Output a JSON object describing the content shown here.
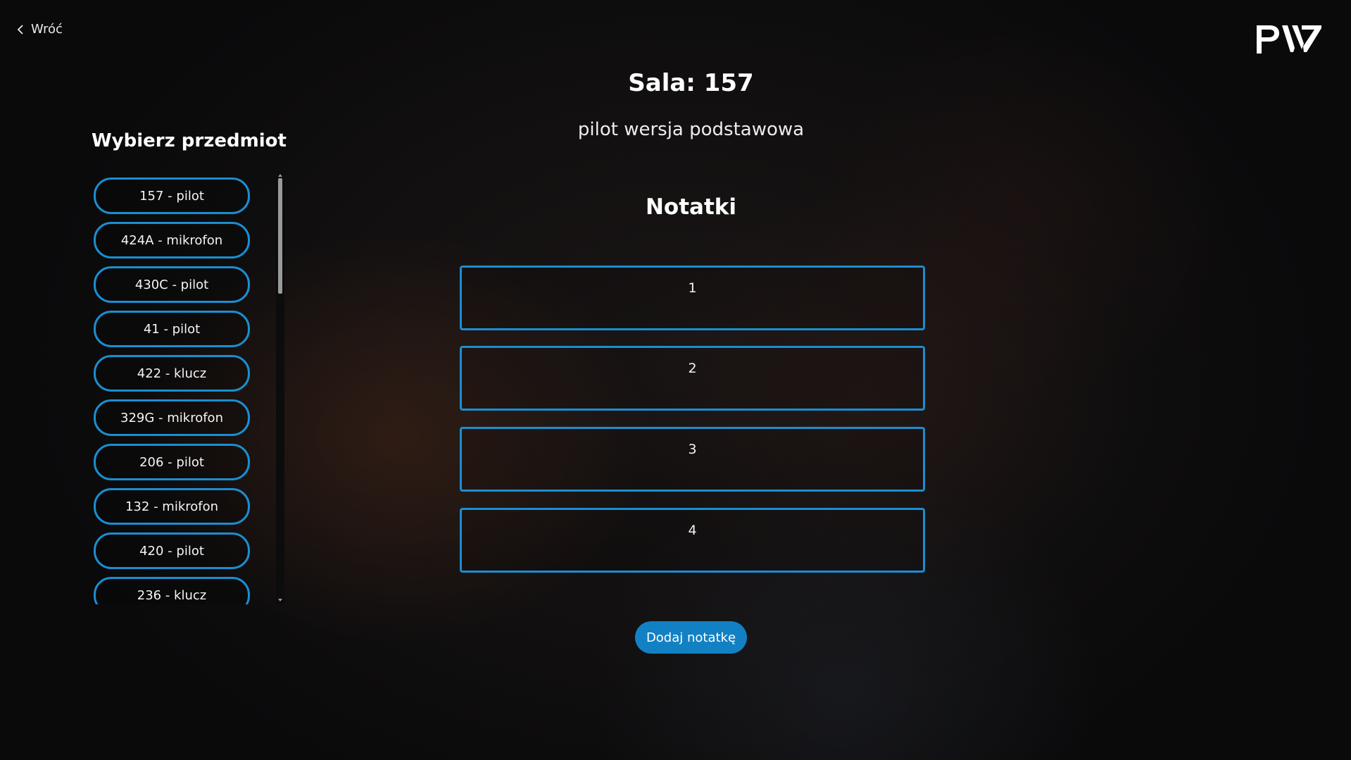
{
  "nav": {
    "back_label": "Wróć"
  },
  "logo": {
    "text": "PW"
  },
  "room": {
    "title": "Sala: 157",
    "subtitle": "pilot wersja podstawowa"
  },
  "sidebar": {
    "title": "Wybierz przedmiot",
    "items": [
      {
        "label": "157 - pilot"
      },
      {
        "label": "424A - mikrofon"
      },
      {
        "label": "430C - pilot"
      },
      {
        "label": "41 - pilot"
      },
      {
        "label": "422 - klucz"
      },
      {
        "label": "329G - mikrofon"
      },
      {
        "label": "206 - pilot"
      },
      {
        "label": "132 - mikrofon"
      },
      {
        "label": "420 - pilot"
      },
      {
        "label": "236 - klucz"
      }
    ]
  },
  "notes": {
    "title": "Notatki",
    "items": [
      {
        "text": "1"
      },
      {
        "text": "2"
      },
      {
        "text": "3"
      },
      {
        "text": "4"
      }
    ],
    "add_button_label": "Dodaj notatkę"
  },
  "colors": {
    "accent": "#1a8ed1",
    "button": "#1281c3"
  }
}
